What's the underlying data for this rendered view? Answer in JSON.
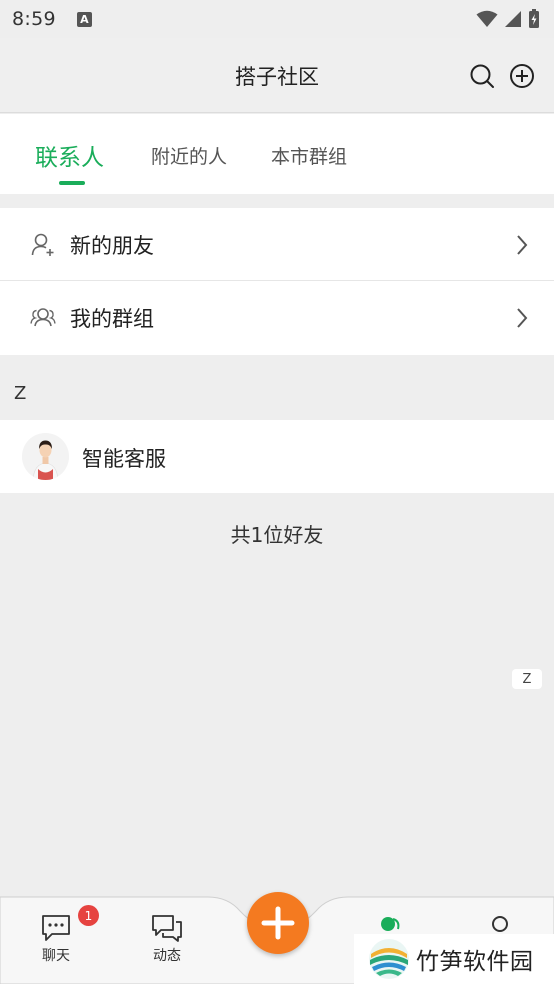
{
  "status_bar": {
    "time": "8:59",
    "notification_icon_letter": "A"
  },
  "header": {
    "title": "搭子社区",
    "search_icon": "search-icon",
    "add_icon": "plus-circle-icon"
  },
  "tabs": [
    {
      "label": "联系人",
      "active": true
    },
    {
      "label": "附近的人",
      "active": false
    },
    {
      "label": "本市群组",
      "active": false
    }
  ],
  "menu": [
    {
      "label": "新的朋友",
      "icon": "add-person-icon"
    },
    {
      "label": "我的群组",
      "icon": "group-icon"
    }
  ],
  "section_letter": "Z",
  "contacts": [
    {
      "name": "智能客服",
      "avatar": "customer-service-avatar"
    }
  ],
  "friend_count_text": "共1位好友",
  "index_bar": {
    "letter": "Z"
  },
  "bottom_nav": {
    "items": [
      {
        "label": "聊天",
        "icon": "chat-bubble-icon",
        "badge": "1"
      },
      {
        "label": "动态",
        "icon": "feed-bubbles-icon"
      },
      {
        "label": "",
        "icon": "contacts-icon",
        "active": true
      },
      {
        "label": "",
        "icon": "profile-icon"
      }
    ],
    "fab_icon": "plus-icon"
  },
  "watermark": {
    "text": "竹笋软件园"
  },
  "colors": {
    "accent_green": "#1aad5a",
    "fab_orange": "#f47a20",
    "badge_red": "#e64340"
  }
}
